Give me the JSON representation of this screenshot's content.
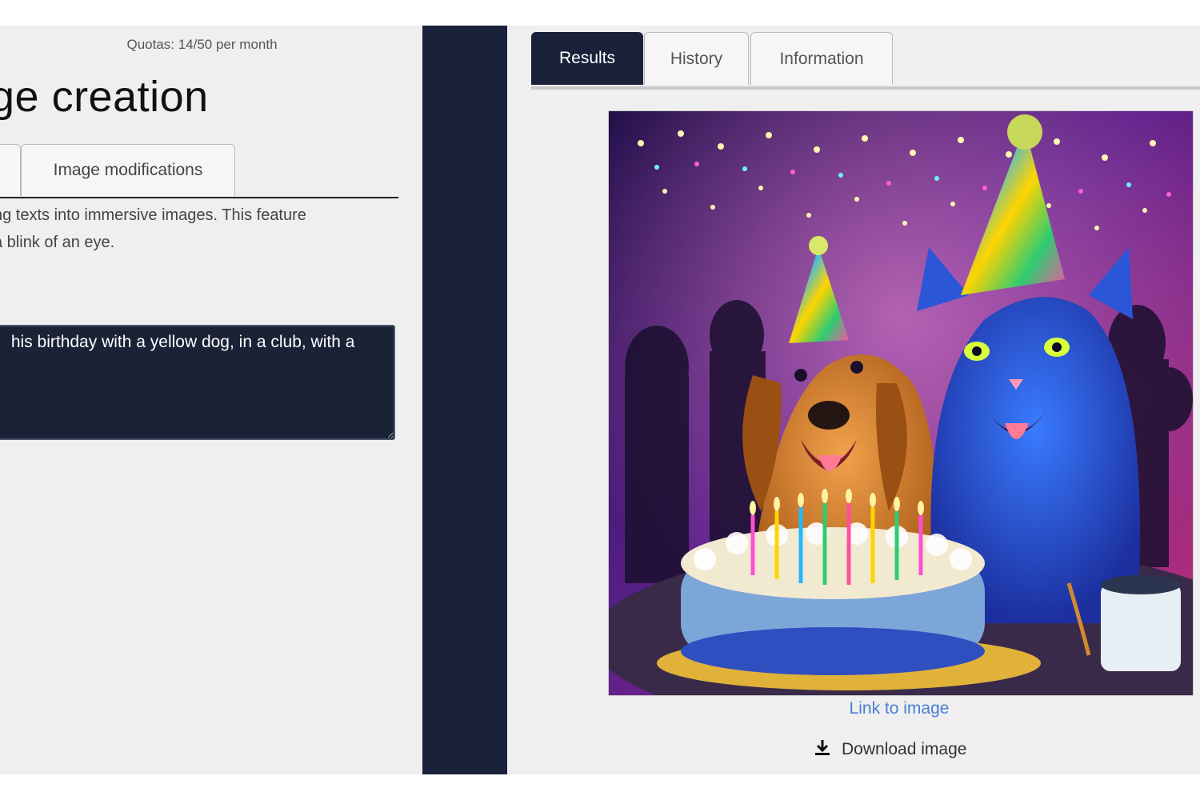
{
  "left": {
    "quota": "Quotas: 14/50 per month",
    "title": "ge creation",
    "tabs": {
      "modifications": "Image modifications"
    },
    "description": [
      "ng texts into immersive images. This feature",
      "a blink of an eye."
    ],
    "prompt_value": " his birthday with a yellow dog, in a club, with a"
  },
  "right": {
    "tabs": [
      "Results",
      "History",
      "Information"
    ],
    "link": "Link to image",
    "download": "Download image"
  },
  "colors": {
    "dark": "#19223a",
    "link": "#4a7fd4",
    "panel": "#efefef"
  },
  "icons": {
    "download": "download-icon"
  }
}
